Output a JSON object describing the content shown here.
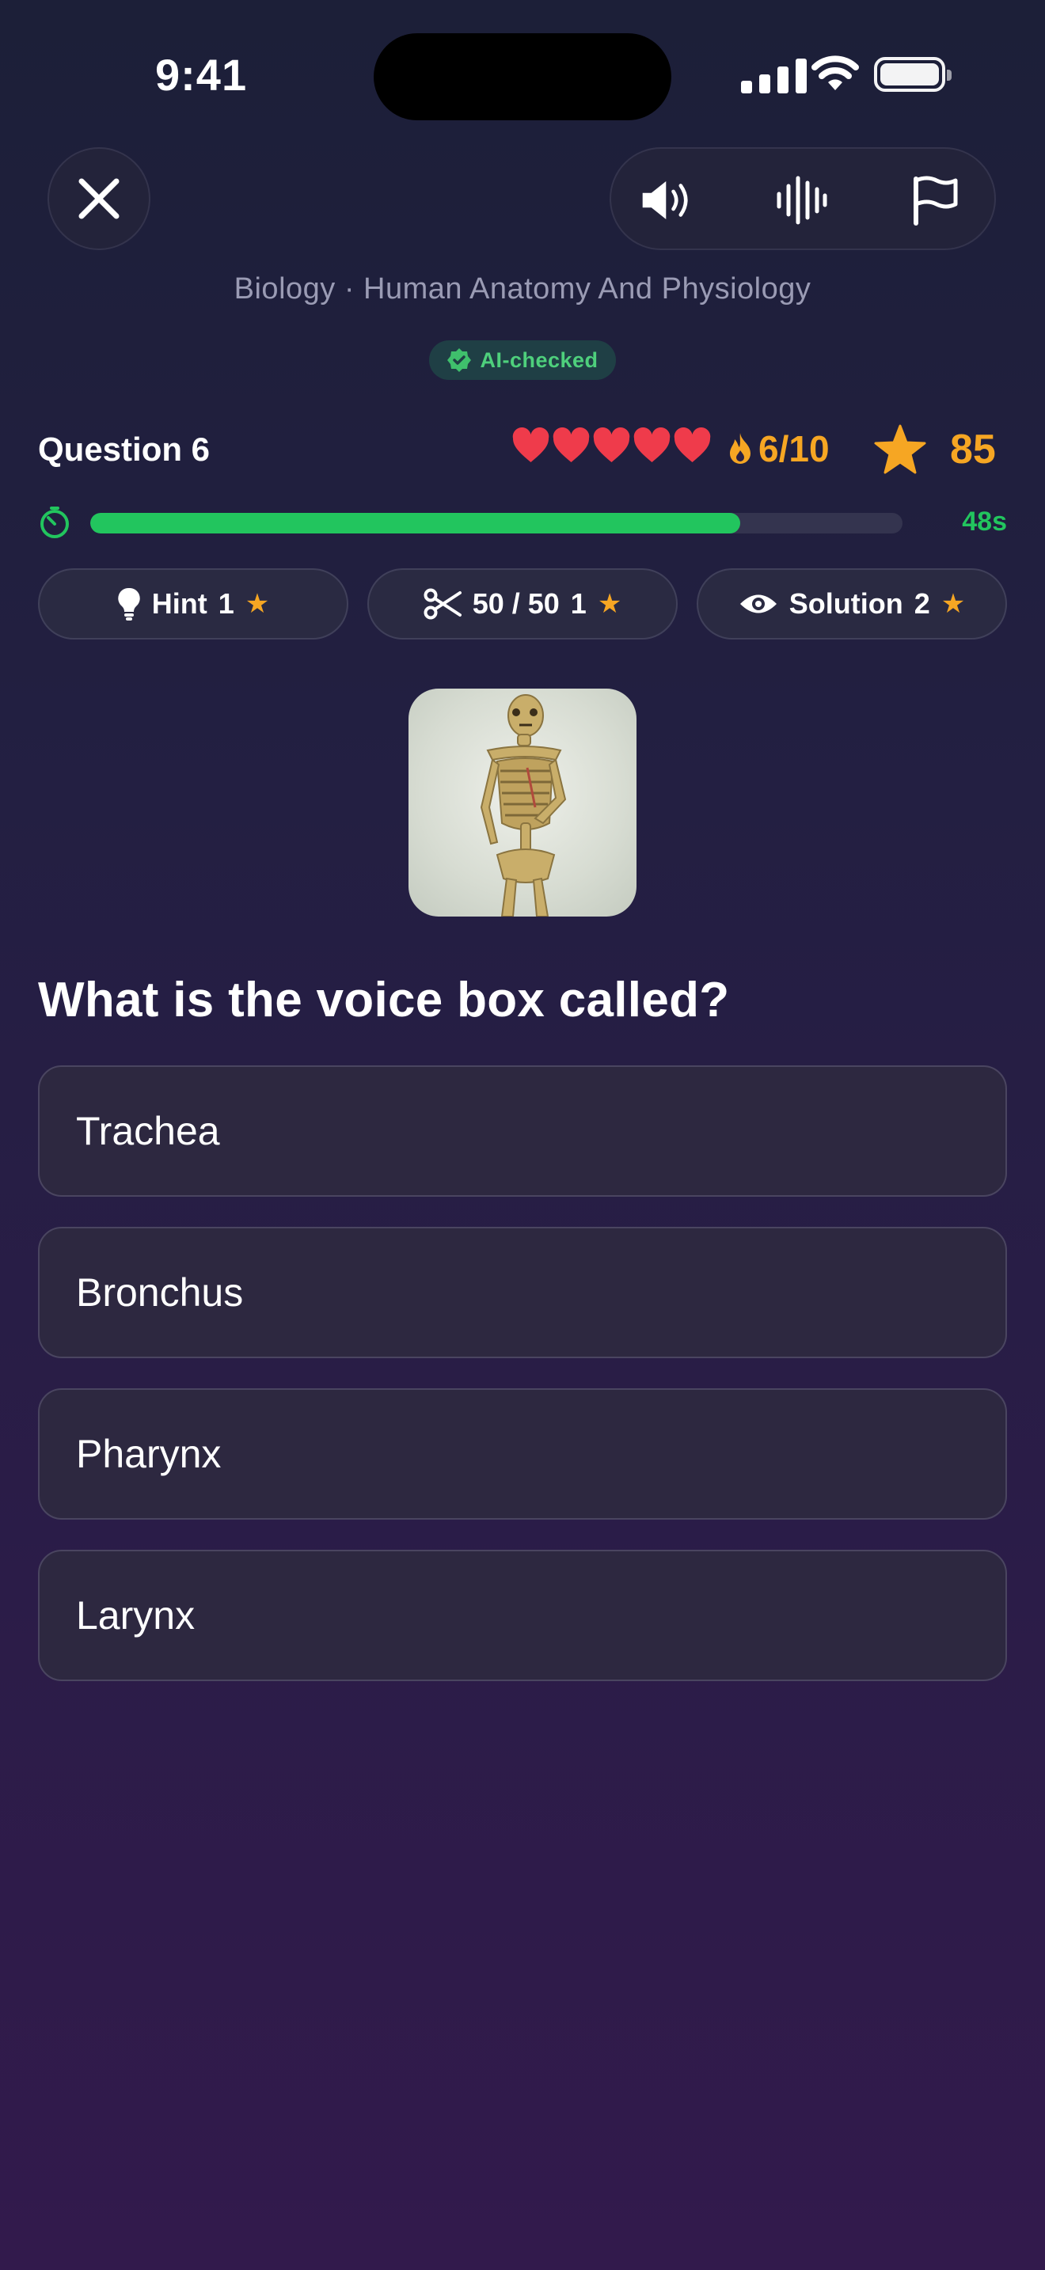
{
  "status_bar": {
    "time": "9:41"
  },
  "header": {
    "category": "Biology · Human Anatomy And Physiology",
    "ai_badge": "AI-checked"
  },
  "stats": {
    "question_label": "Question 6",
    "hearts_count": 5,
    "streak": "6/10",
    "score": "85",
    "timer_text": "48s",
    "timer_progress": 0.8,
    "accent_green": "#22c55e",
    "accent_orange": "#f6a623",
    "heart_color": "#ef3b4b"
  },
  "powerups": [
    {
      "label": "Hint",
      "cost": "1",
      "icon": "lightbulb-icon"
    },
    {
      "label": "50 / 50",
      "cost": "1",
      "icon": "scissors-icon"
    },
    {
      "label": "Solution",
      "cost": "2",
      "icon": "eye-icon"
    }
  ],
  "question": {
    "text": "What is the voice box called?",
    "image": "skeleton-image"
  },
  "answers": [
    "Trachea",
    "Bronchus",
    "Pharynx",
    "Larynx"
  ]
}
